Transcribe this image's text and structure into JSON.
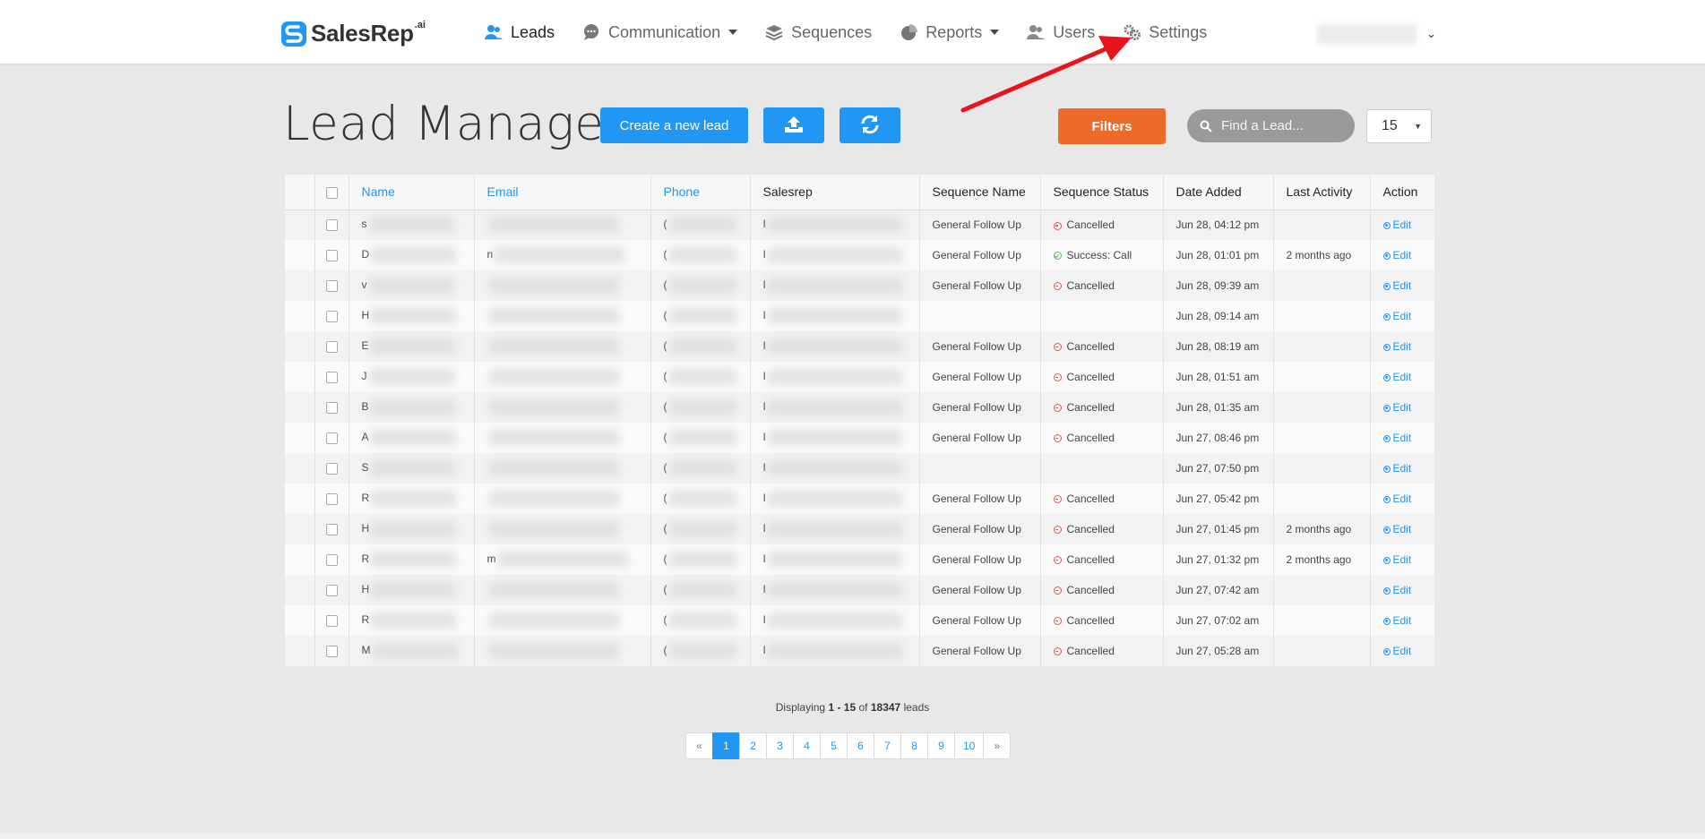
{
  "brand": {
    "name": "SalesRep",
    "suffix": ".ai"
  },
  "nav": {
    "items": [
      {
        "label": "Leads",
        "icon": "users-icon",
        "active": true,
        "dropdown": false
      },
      {
        "label": "Communication",
        "icon": "chat-bubble-icon",
        "active": false,
        "dropdown": true
      },
      {
        "label": "Sequences",
        "icon": "layers-icon",
        "active": false,
        "dropdown": false
      },
      {
        "label": "Reports",
        "icon": "pie-chart-icon",
        "active": false,
        "dropdown": true
      },
      {
        "label": "Users",
        "icon": "users-icon",
        "active": false,
        "dropdown": false
      },
      {
        "label": "Settings",
        "icon": "gears-icon",
        "active": false,
        "dropdown": false
      }
    ],
    "user_menu_chevron": "⌄"
  },
  "page": {
    "title": "Lead Manager",
    "create_button": "Create a new lead",
    "upload_icon": "upload-icon",
    "refresh_icon": "refresh-icon",
    "filters_button": "Filters",
    "search_placeholder": "Find a Lead...",
    "per_page_value": "15"
  },
  "colors": {
    "primary": "#2196f3",
    "filters": "#ed6a2b",
    "cancelled": "#e05a4f",
    "success": "#5bb85b",
    "arrow": "#e8141b"
  },
  "table": {
    "headers": {
      "name": "Name",
      "email": "Email",
      "phone": "Phone",
      "salesrep": "Salesrep",
      "sequence_name": "Sequence Name",
      "sequence_status": "Sequence Status",
      "date_added": "Date Added",
      "last_activity": "Last Activity",
      "action": "Action"
    },
    "edit_label": "Edit",
    "rows": [
      {
        "name": "s",
        "email": "",
        "phone": "(",
        "salesrep": "I",
        "sequence_name": "General Follow Up",
        "status": "Cancelled",
        "status_type": "cancel",
        "date_added": "Jun 28, 04:12 pm",
        "last_activity": ""
      },
      {
        "name": "D",
        "email": "n",
        "phone": "(",
        "salesrep": "I",
        "sequence_name": "General Follow Up",
        "status": "Success: Call",
        "status_type": "success",
        "date_added": "Jun 28, 01:01 pm",
        "last_activity": "2 months ago"
      },
      {
        "name": "v",
        "email": "",
        "phone": "(",
        "salesrep": "I",
        "sequence_name": "General Follow Up",
        "status": "Cancelled",
        "status_type": "cancel",
        "date_added": "Jun 28, 09:39 am",
        "last_activity": ""
      },
      {
        "name": "H",
        "email": "",
        "phone": "(",
        "salesrep": "I",
        "sequence_name": "",
        "status": "",
        "status_type": "",
        "date_added": "Jun 28, 09:14 am",
        "last_activity": ""
      },
      {
        "name": "E",
        "email": "",
        "phone": "(",
        "salesrep": "I",
        "sequence_name": "General Follow Up",
        "status": "Cancelled",
        "status_type": "cancel",
        "date_added": "Jun 28, 08:19 am",
        "last_activity": ""
      },
      {
        "name": "J",
        "email": "",
        "phone": "(",
        "salesrep": "I",
        "sequence_name": "General Follow Up",
        "status": "Cancelled",
        "status_type": "cancel",
        "date_added": "Jun 28, 01:51 am",
        "last_activity": ""
      },
      {
        "name": "B",
        "email": "",
        "phone": "(",
        "salesrep": "I",
        "sequence_name": "General Follow Up",
        "status": "Cancelled",
        "status_type": "cancel",
        "date_added": "Jun 28, 01:35 am",
        "last_activity": ""
      },
      {
        "name": "A",
        "email": "",
        "phone": "(",
        "salesrep": "I",
        "sequence_name": "General Follow Up",
        "status": "Cancelled",
        "status_type": "cancel",
        "date_added": "Jun 27, 08:46 pm",
        "last_activity": ""
      },
      {
        "name": "S",
        "email": "",
        "phone": "(",
        "salesrep": "I",
        "sequence_name": "",
        "status": "",
        "status_type": "",
        "date_added": "Jun 27, 07:50 pm",
        "last_activity": ""
      },
      {
        "name": "R",
        "email": "",
        "phone": "(",
        "salesrep": "I",
        "sequence_name": "General Follow Up",
        "status": "Cancelled",
        "status_type": "cancel",
        "date_added": "Jun 27, 05:42 pm",
        "last_activity": ""
      },
      {
        "name": "H",
        "email": "",
        "phone": "(",
        "salesrep": "I",
        "sequence_name": "General Follow Up",
        "status": "Cancelled",
        "status_type": "cancel",
        "date_added": "Jun 27, 01:45 pm",
        "last_activity": "2 months ago"
      },
      {
        "name": "R",
        "email": "m",
        "phone": "(",
        "salesrep": "I",
        "sequence_name": "General Follow Up",
        "status": "Cancelled",
        "status_type": "cancel",
        "date_added": "Jun 27, 01:32 pm",
        "last_activity": "2 months ago"
      },
      {
        "name": "H",
        "email": "",
        "phone": "(",
        "salesrep": "I",
        "sequence_name": "General Follow Up",
        "status": "Cancelled",
        "status_type": "cancel",
        "date_added": "Jun 27, 07:42 am",
        "last_activity": ""
      },
      {
        "name": "R",
        "email": "",
        "phone": "(",
        "salesrep": "I",
        "sequence_name": "General Follow Up",
        "status": "Cancelled",
        "status_type": "cancel",
        "date_added": "Jun 27, 07:02 am",
        "last_activity": ""
      },
      {
        "name": "M",
        "email": "",
        "phone": "(",
        "salesrep": "I",
        "sequence_name": "General Follow Up",
        "status": "Cancelled",
        "status_type": "cancel",
        "date_added": "Jun 27, 05:28 am",
        "last_activity": ""
      }
    ]
  },
  "summary": {
    "prefix": "Displaying",
    "range": "1 - 15",
    "of": "of",
    "total": "18347",
    "suffix": "leads"
  },
  "pagination": {
    "prev": "«",
    "pages": [
      "1",
      "2",
      "3",
      "4",
      "5",
      "6",
      "7",
      "8",
      "9",
      "10"
    ],
    "current": "1",
    "next": "»"
  }
}
